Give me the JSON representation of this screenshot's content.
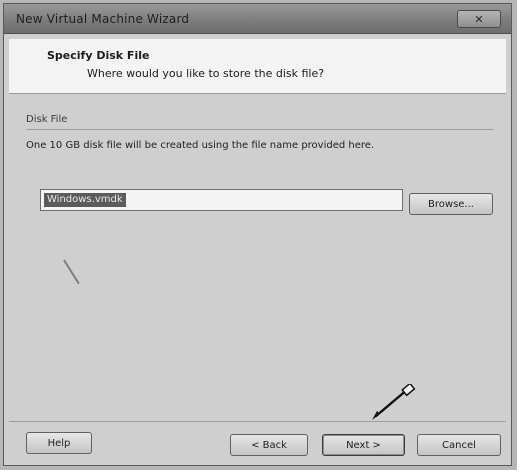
{
  "window": {
    "title": "New Virtual Machine Wizard",
    "close_icon": "close-icon"
  },
  "header": {
    "title": "Specify Disk File",
    "subtitle": "Where would you like to store the disk file?"
  },
  "disk_file": {
    "group_label": "Disk File",
    "description": "One 10 GB disk file will be created using the file name provided here.",
    "value": "Windows.vmdk"
  },
  "buttons": {
    "browse": "Browse...",
    "help": "Help",
    "back": "< Back",
    "next": "Next >",
    "cancel": "Cancel"
  },
  "annotation": {
    "pointer_icon": "pen-pointer-icon"
  }
}
